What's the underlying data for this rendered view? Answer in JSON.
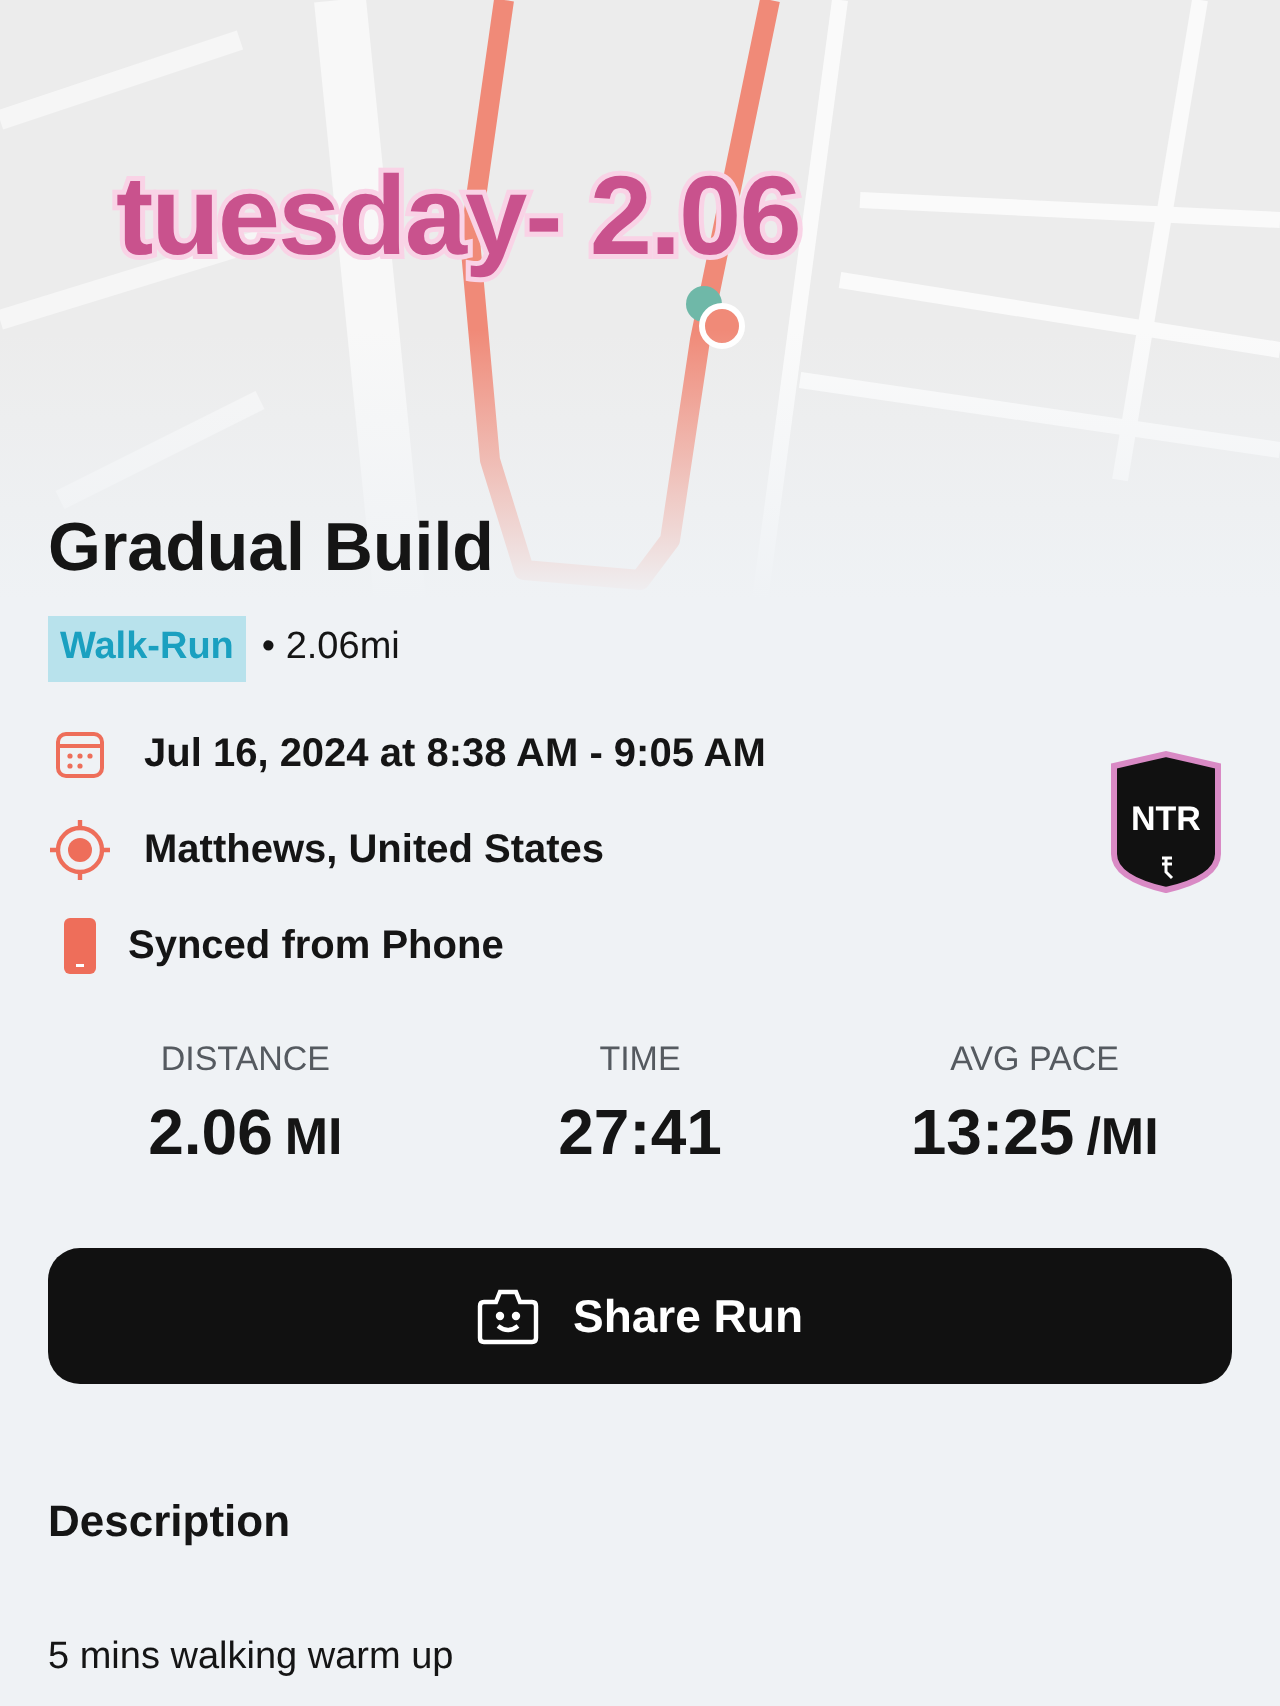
{
  "map": {
    "caption": "tuesday- 2.06"
  },
  "workout": {
    "title": "Gradual Build",
    "type_tag": "Walk-Run",
    "distance_note": "• 2.06mi"
  },
  "details": [
    {
      "kind": "date",
      "text": "Jul 16, 2024 at 8:38 AM - 9:05 AM"
    },
    {
      "kind": "location",
      "text": "Matthews, United States"
    },
    {
      "kind": "device",
      "text": "Synced from Phone"
    }
  ],
  "badge": {
    "text": "NTR"
  },
  "stats": [
    {
      "label": "DISTANCE",
      "value": "2.06",
      "unit": "MI"
    },
    {
      "label": "TIME",
      "value": "27:41"
    },
    {
      "label": "AVG PACE",
      "value": "13:25",
      "unit": "/MI"
    }
  ],
  "share_button": {
    "label": "Share Run"
  },
  "description": {
    "heading": "Description",
    "text": "5 mins walking warm up"
  }
}
